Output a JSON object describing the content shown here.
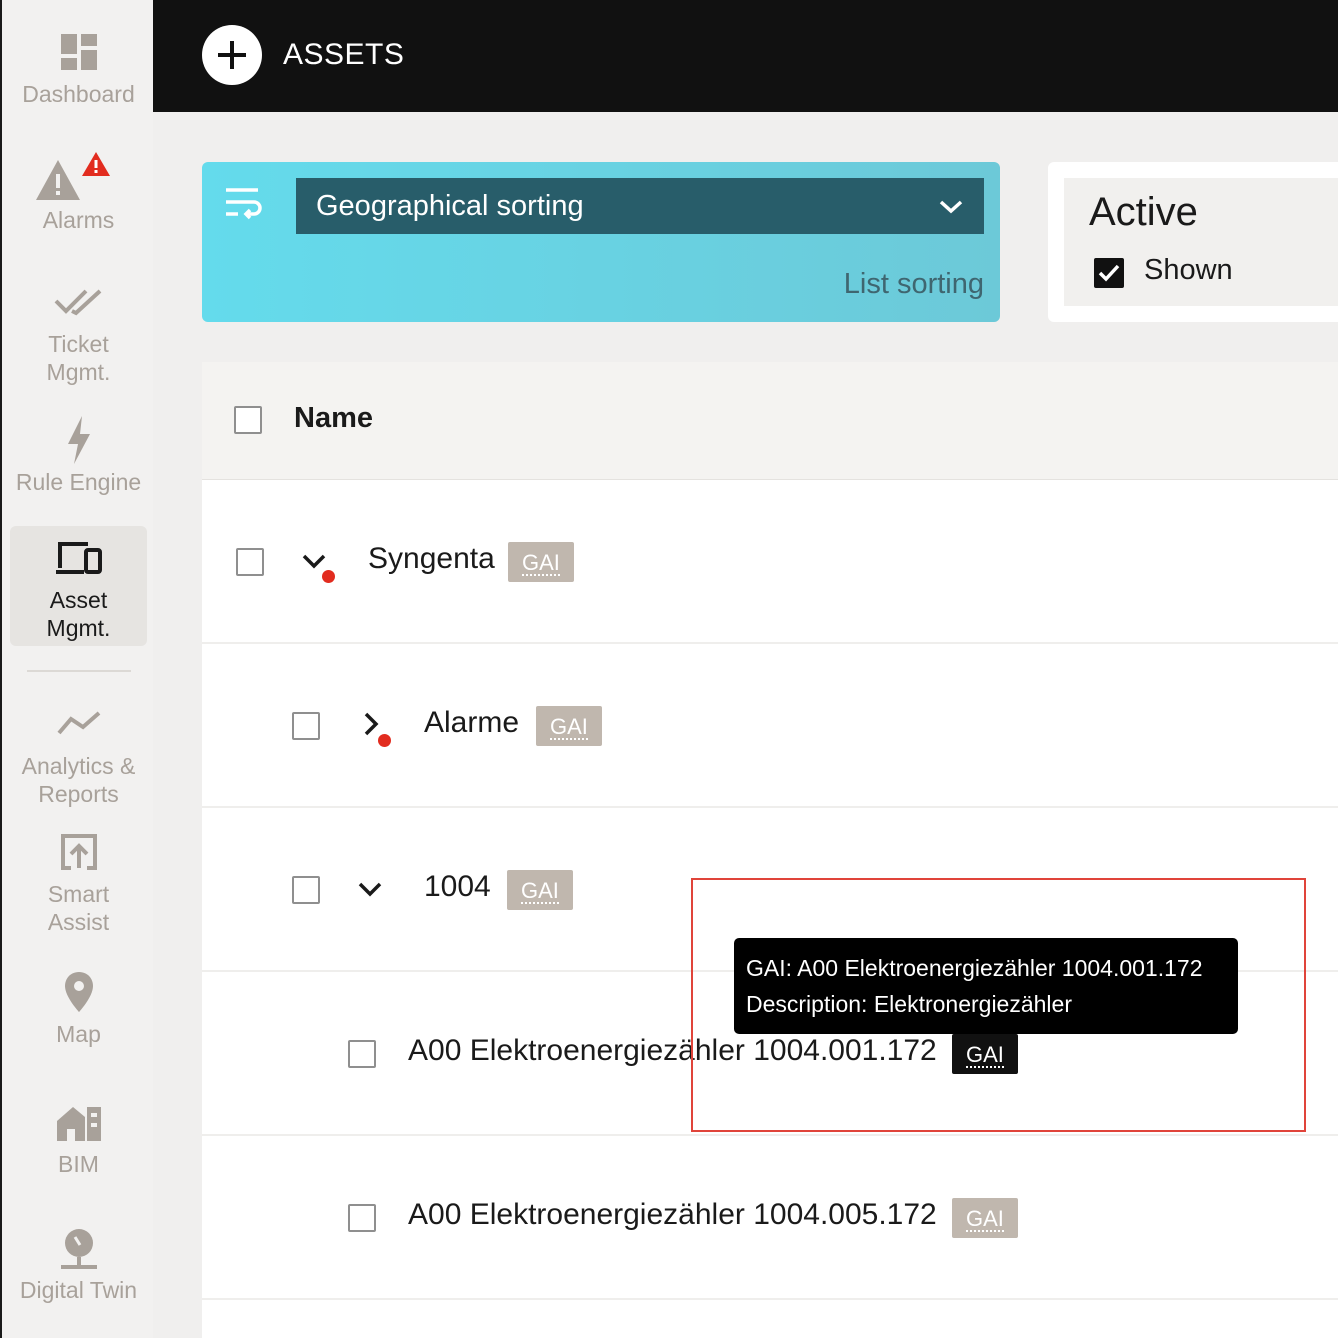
{
  "sidebar": {
    "items": [
      {
        "label": "Dashboard",
        "icon": "dashboard-icon"
      },
      {
        "label": "Alarms",
        "icon": "warning-icon"
      },
      {
        "label": "Ticket\nMgmt.",
        "icon": "double-check-icon"
      },
      {
        "label": "Rule Engine",
        "icon": "lightning-icon"
      },
      {
        "label": "Asset\nMgmt.",
        "icon": "devices-icon"
      },
      {
        "label": "Analytics &\nReports",
        "icon": "line-chart-icon"
      },
      {
        "label": "Smart\nAssist",
        "icon": "upload-box-icon"
      },
      {
        "label": "Map",
        "icon": "map-pin-icon"
      },
      {
        "label": "BIM",
        "icon": "building-icon"
      },
      {
        "label": "Digital Twin",
        "icon": "joystick-icon"
      }
    ],
    "active_item": "Asset\nMgmt."
  },
  "header": {
    "title": "ASSETS"
  },
  "sorting": {
    "selected": "Geographical sorting",
    "alternative": "List sorting"
  },
  "filter": {
    "title": "Active",
    "shown_label": "Shown",
    "shown_checked": true
  },
  "table": {
    "column_name": "Name",
    "rows": [
      {
        "name": "Syngenta",
        "badge": "GAI",
        "expanded": true,
        "alarm": true
      },
      {
        "name": "Alarme",
        "badge": "GAI",
        "expanded": false,
        "alarm": true
      },
      {
        "name": "1004",
        "badge": "GAI",
        "expanded": true,
        "alarm": false
      },
      {
        "name": "A00 Elektroenergiezähler 1004.001.172",
        "badge": "GAI",
        "expanded": null,
        "alarm": false
      },
      {
        "name": "A00 Elektroenergiezähler 1004.005.172",
        "badge": "GAI",
        "expanded": null,
        "alarm": false
      }
    ]
  },
  "tooltip": {
    "line1": "GAI: A00 Elektroenergiezähler 1004.001.172",
    "line2": "Description: Elektronergiezähler"
  },
  "colors": {
    "header_bg": "#111111",
    "sort_select_bg": "#285d6a",
    "sort_panel_gradient_start": "#64dbec",
    "badge_bg": "#c0b7ae",
    "alarm_dot": "#e22c1f",
    "highlight_border": "#e0443a"
  }
}
